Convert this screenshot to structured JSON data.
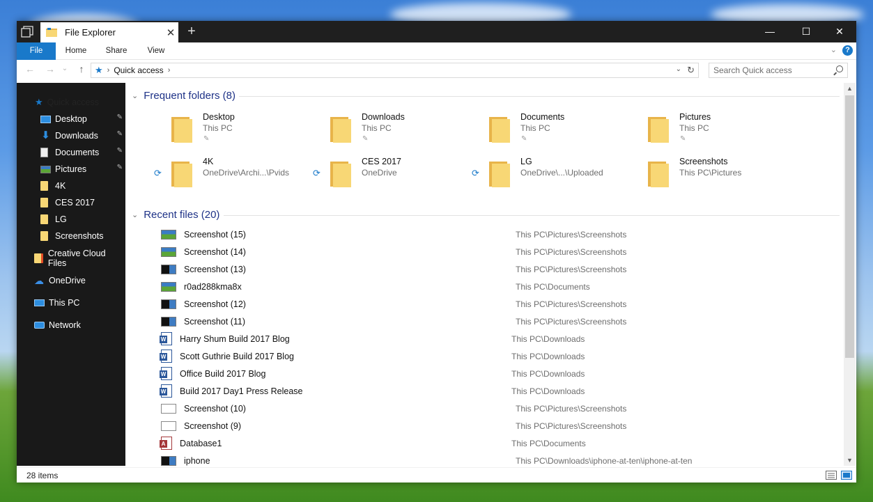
{
  "window": {
    "tab_title": "File Explorer",
    "close_tab": "✕",
    "new_tab": "+",
    "minimize": "—",
    "maximize": "☐",
    "close": "✕"
  },
  "ribbon": {
    "tabs": [
      "File",
      "Home",
      "Share",
      "View"
    ],
    "help": "?",
    "expand_glyph": "⌄"
  },
  "address": {
    "back": "←",
    "forward": "→",
    "recent": "⌄",
    "up": "↑",
    "sep": "›",
    "crumb": "Quick access",
    "dropdown": "⌄",
    "refresh": "↻",
    "search_placeholder": "Search Quick access"
  },
  "nav": {
    "quick_access": "Quick access",
    "pinned": [
      {
        "label": "Desktop",
        "icon": "desktop-icon"
      },
      {
        "label": "Downloads",
        "icon": "download-icon"
      },
      {
        "label": "Documents",
        "icon": "documents-icon"
      },
      {
        "label": "Pictures",
        "icon": "pictures-icon"
      }
    ],
    "folders": [
      "4K",
      "CES 2017",
      "LG",
      "Screenshots"
    ],
    "roots": [
      {
        "label": "Creative Cloud Files",
        "icon": "creative-cloud-icon"
      },
      {
        "label": "OneDrive",
        "icon": "onedrive-icon"
      },
      {
        "label": "This PC",
        "icon": "this-pc-icon"
      },
      {
        "label": "Network",
        "icon": "network-icon"
      }
    ],
    "pin_glyph": "📌"
  },
  "frequent": {
    "title": "Frequent folders (8)",
    "collapse": "⌄",
    "items": [
      {
        "name": "Desktop",
        "sub": "This PC",
        "pinned": true,
        "sync": false
      },
      {
        "name": "Downloads",
        "sub": "This PC",
        "pinned": true,
        "sync": false
      },
      {
        "name": "Documents",
        "sub": "This PC",
        "pinned": true,
        "sync": false
      },
      {
        "name": "Pictures",
        "sub": "This PC",
        "pinned": true,
        "sync": false
      },
      {
        "name": "4K",
        "sub": "OneDrive\\Archi...\\Pvids",
        "pinned": false,
        "sync": true
      },
      {
        "name": "CES 2017",
        "sub": "OneDrive",
        "pinned": false,
        "sync": true
      },
      {
        "name": "LG",
        "sub": "OneDrive\\...\\Uploaded",
        "pinned": false,
        "sync": true
      },
      {
        "name": "Screenshots",
        "sub": "This PC\\Pictures",
        "pinned": false,
        "sync": false
      }
    ]
  },
  "recent": {
    "title": "Recent files (20)",
    "collapse": "⌄",
    "items": [
      {
        "name": "Screenshot (15)",
        "path": "This PC\\Pictures\\Screenshots",
        "type": "img"
      },
      {
        "name": "Screenshot (14)",
        "path": "This PC\\Pictures\\Screenshots",
        "type": "img"
      },
      {
        "name": "Screenshot (13)",
        "path": "This PC\\Pictures\\Screenshots",
        "type": "scr"
      },
      {
        "name": "r0ad288kma8x",
        "path": "This PC\\Documents",
        "type": "img"
      },
      {
        "name": "Screenshot (12)",
        "path": "This PC\\Pictures\\Screenshots",
        "type": "scr"
      },
      {
        "name": "Screenshot (11)",
        "path": "This PC\\Pictures\\Screenshots",
        "type": "scr"
      },
      {
        "name": "Harry Shum Build 2017 Blog",
        "path": "This PC\\Downloads",
        "type": "word"
      },
      {
        "name": "Scott Guthrie Build 2017 Blog",
        "path": "This PC\\Downloads",
        "type": "word"
      },
      {
        "name": "Office Build 2017 Blog",
        "path": "This PC\\Downloads",
        "type": "word"
      },
      {
        "name": "Build 2017 Day1 Press Release",
        "path": "This PC\\Downloads",
        "type": "word"
      },
      {
        "name": "Screenshot (10)",
        "path": "This PC\\Pictures\\Screenshots",
        "type": "blank"
      },
      {
        "name": "Screenshot (9)",
        "path": "This PC\\Pictures\\Screenshots",
        "type": "blank"
      },
      {
        "name": "Database1",
        "path": "This PC\\Documents",
        "type": "access"
      },
      {
        "name": "iphone",
        "path": "This PC\\Downloads\\iphone-at-ten\\iphone-at-ten",
        "type": "scr"
      }
    ]
  },
  "scrollbar": {
    "up": "▲",
    "down": "▼"
  },
  "status": {
    "count": "28 items"
  }
}
